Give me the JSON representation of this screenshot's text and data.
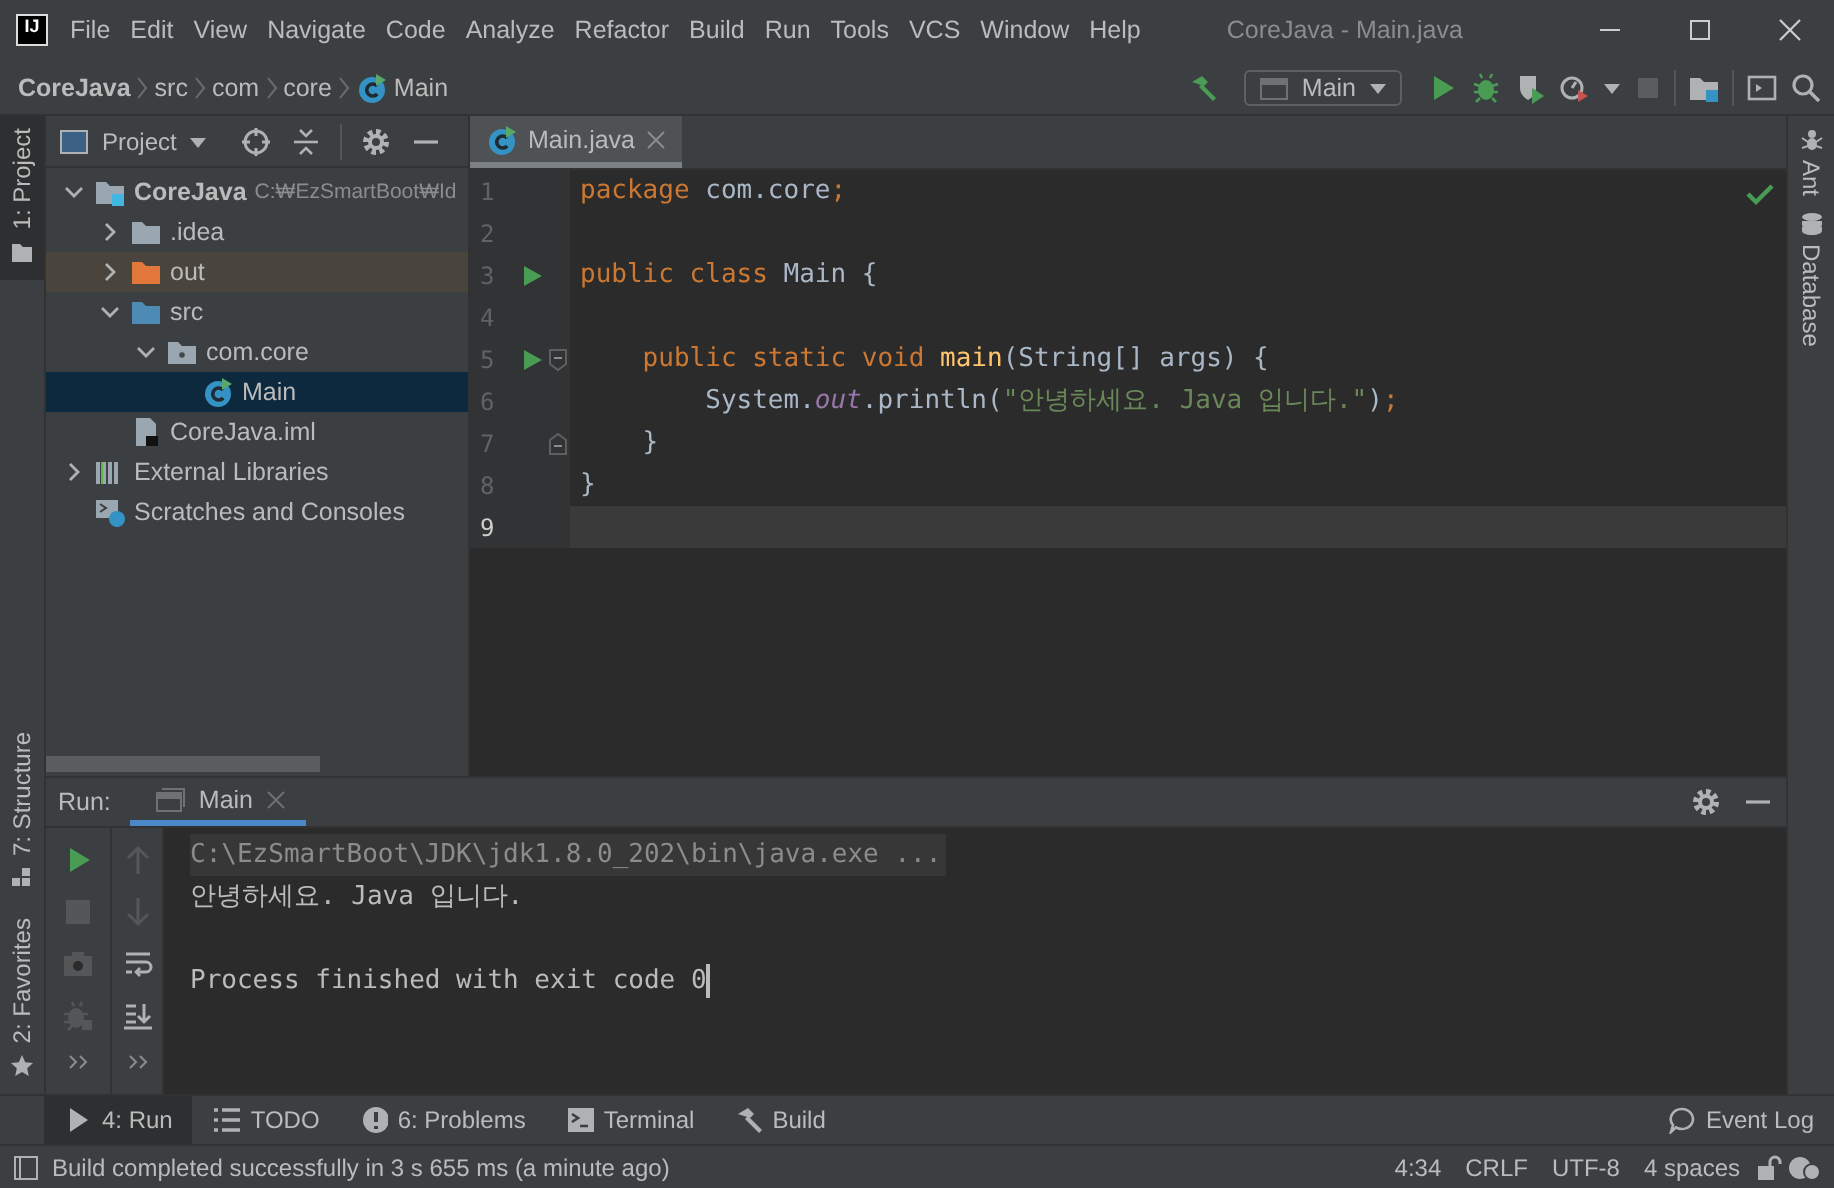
{
  "window": {
    "logo": "IJ",
    "title": "CoreJava - Main.java"
  },
  "menu": [
    "File",
    "Edit",
    "View",
    "Navigate",
    "Code",
    "Analyze",
    "Refactor",
    "Build",
    "Run",
    "Tools",
    "VCS",
    "Window",
    "Help"
  ],
  "navbar": {
    "breadcrumbs": [
      {
        "label": "CoreJava",
        "kind": "project"
      },
      {
        "label": "src",
        "kind": "directory"
      },
      {
        "label": "com",
        "kind": "directory"
      },
      {
        "label": "core",
        "kind": "directory"
      },
      {
        "label": "Main",
        "kind": "class"
      }
    ],
    "run_config": "Main",
    "stop_button": {
      "disabled": true
    }
  },
  "left_stripe": [
    {
      "label": "1: Project",
      "kind": "project",
      "selected": true
    },
    {
      "label": "7: Structure",
      "kind": "structure",
      "selected": false
    },
    {
      "label": "2: Favorites",
      "kind": "favorites",
      "selected": false
    }
  ],
  "project_panel": {
    "title": "Project",
    "tree": [
      {
        "label": "CoreJava",
        "kind": "module",
        "path": "C:₩EzSmartBoot₩Id",
        "expanded": true,
        "selected": false,
        "children": [
          {
            "label": ".idea",
            "kind": "folder",
            "expanded": false,
            "selected": false
          },
          {
            "label": "out",
            "kind": "excluded-folder",
            "expanded": false,
            "selected": false
          },
          {
            "label": "src",
            "kind": "source-folder",
            "expanded": true,
            "selected": false,
            "children": [
              {
                "label": "com.core",
                "kind": "package",
                "expanded": true,
                "selected": false,
                "children": [
                  {
                    "label": "Main",
                    "kind": "class",
                    "selected": true
                  }
                ]
              }
            ]
          },
          {
            "label": "CoreJava.iml",
            "kind": "iml",
            "selected": false
          }
        ]
      },
      {
        "label": "External Libraries",
        "kind": "libraries",
        "expanded": false,
        "selected": false
      },
      {
        "label": "Scratches and Consoles",
        "kind": "scratches",
        "selected": false
      }
    ]
  },
  "editor": {
    "tabs": [
      {
        "label": "Main.java",
        "selected": true
      }
    ],
    "inspection_ok": true,
    "lines": [
      {
        "number": "1",
        "current": false,
        "run_marker": false,
        "tokens": [
          {
            "text": "package",
            "kind": "keyword"
          },
          {
            "text": " com.core",
            "kind": "plain"
          },
          {
            "text": ";",
            "kind": "keyword"
          }
        ]
      },
      {
        "number": "2",
        "current": false,
        "run_marker": false
      },
      {
        "number": "3",
        "current": false,
        "run_marker": true,
        "tokens": [
          {
            "text": "public class",
            "kind": "keyword"
          },
          {
            "text": " Main {",
            "kind": "plain"
          }
        ]
      },
      {
        "number": "4",
        "current": false,
        "run_marker": false
      },
      {
        "number": "5",
        "current": false,
        "run_marker": true,
        "fold_start": true,
        "tokens": [
          {
            "text": "    public static void ",
            "kind": "keyword"
          },
          {
            "text": "main",
            "kind": "method"
          },
          {
            "text": "(String[] args) {",
            "kind": "plain"
          }
        ]
      },
      {
        "number": "6",
        "current": false,
        "run_marker": false,
        "tokens": [
          {
            "text": "        System.",
            "kind": "plain"
          },
          {
            "text": "out",
            "kind": "static-field"
          },
          {
            "text": ".println(",
            "kind": "plain"
          },
          {
            "text": "\"안녕하세요. Java 입니다.\"",
            "kind": "string"
          },
          {
            "text": ")",
            "kind": "plain"
          },
          {
            "text": ";",
            "kind": "keyword"
          }
        ]
      },
      {
        "number": "7",
        "current": false,
        "run_marker": false,
        "fold_end": true,
        "tokens": [
          {
            "text": "    }",
            "kind": "plain"
          }
        ]
      },
      {
        "number": "8",
        "current": false,
        "run_marker": false,
        "tokens": [
          {
            "text": "}",
            "kind": "plain"
          }
        ]
      },
      {
        "number": "9",
        "current": true,
        "run_marker": false
      }
    ]
  },
  "right_stripe": [
    {
      "label": "Ant",
      "kind": "ant"
    },
    {
      "label": "Database",
      "kind": "database"
    }
  ],
  "run_panel": {
    "label": "Run:",
    "tabs": [
      {
        "label": "Main",
        "selected": true
      }
    ],
    "stop_button": {
      "disabled": true
    },
    "console": [
      {
        "kind": "command",
        "text": "C:\\EzSmartBoot\\JDK\\jdk1.8.0_202\\bin\\java.exe ..."
      },
      {
        "kind": "output",
        "text": "안녕하세요. Java 입니다."
      },
      {
        "kind": "exit",
        "text": "Process finished with exit code 0"
      }
    ]
  },
  "tool_tabs": [
    {
      "label": "4: Run",
      "kind": "run",
      "selected": true
    },
    {
      "label": "TODO",
      "kind": "todo",
      "selected": false
    },
    {
      "label": "6: Problems",
      "kind": "problems",
      "selected": false
    },
    {
      "label": "Terminal",
      "kind": "terminal",
      "selected": false
    },
    {
      "label": "Build",
      "kind": "build",
      "selected": false
    }
  ],
  "event_log": "Event Log",
  "status_bar": {
    "message": "Build completed successfully in 3 s 655 ms (a minute ago)",
    "items": [
      "4:34",
      "CRLF",
      "UTF-8",
      "4 spaces"
    ]
  }
}
